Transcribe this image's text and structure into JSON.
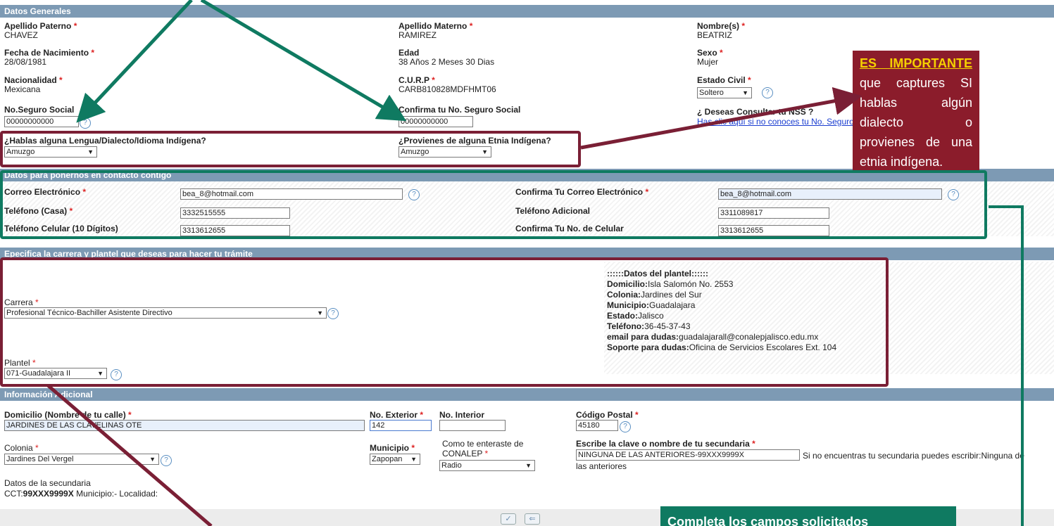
{
  "sections": {
    "general": "Datos Generales",
    "contact": "Datos para ponernos en contacto contigo",
    "career": "Epecifica la carrera y plantel que deseas para hacer tu trámite",
    "additional": "Información Adicional"
  },
  "general": {
    "apellido_paterno": {
      "label": "Apellido Paterno",
      "value": "CHAVEZ"
    },
    "apellido_materno": {
      "label": "Apellido Materno",
      "value": "RAMIREZ"
    },
    "nombre": {
      "label": "Nombre(s)",
      "value": "BEATRIZ"
    },
    "fecha_nacimiento": {
      "label": "Fecha de Nacimiento",
      "value": "28/08/1981"
    },
    "edad": {
      "label": "Edad",
      "value": "38 Años 2 Meses 30 Dias"
    },
    "sexo": {
      "label": "Sexo",
      "value": "Mujer"
    },
    "nacionalidad": {
      "label": "Nacionalidad",
      "value": "Mexicana"
    },
    "curp": {
      "label": "C.U.R.P",
      "value": "CARB810828MDFHMT06"
    },
    "estado_civil": {
      "label": "Estado Civil",
      "value": "Soltero"
    },
    "nss": {
      "label": "No.Seguro Social",
      "value": "00000000000"
    },
    "nss_confirm": {
      "label": "Confirma tu No. Seguro Social",
      "value": "00000000000"
    },
    "consultar_nss": {
      "label": "¿ Deseas Consultar tu NSS ?",
      "link": "Has clic aquí si no conoces tu No. Seguro Social"
    },
    "lengua": {
      "label": "¿Hablas alguna Lengua/Dialecto/Idioma Indígena?",
      "value": "Amuzgo"
    },
    "etnia": {
      "label": "¿Provienes de alguna Etnia Indígena?",
      "value": "Amuzgo"
    }
  },
  "contact": {
    "correo": {
      "label": "Correo Electrónico",
      "value": "bea_8@hotmail.com"
    },
    "correo_confirm": {
      "label": "Confirma Tu Correo Electrónico",
      "value": "bea_8@hotmail.com"
    },
    "tel_casa": {
      "label": "Teléfono (Casa)",
      "value": "3332515555"
    },
    "tel_adicional": {
      "label": "Teléfono Adicional",
      "value": "3311089817"
    },
    "tel_celular": {
      "label": "Teléfono Celular (10 Dígitos)",
      "value": "3313612655"
    },
    "celular_confirm": {
      "label": "Confirma Tu No. de Celular",
      "value": "3313612655"
    }
  },
  "career": {
    "carrera": {
      "label": "Carrera",
      "value": "Profesional Técnico-Bachiller Asistente Directivo"
    },
    "plantel": {
      "label": "Plantel",
      "value": "071-Guadalajara II"
    },
    "plantel_info": {
      "title": "::::::Datos del plantel::::::",
      "domicilio_label": "Domicilio:",
      "domicilio": "Isla Salomón No. 2553",
      "colonia_label": "Colonia:",
      "colonia": "Jardines del Sur",
      "municipio_label": "Municipio:",
      "municipio": "Guadalajara",
      "estado_label": "Estado:",
      "estado": "Jalisco",
      "telefono_label": "Teléfono:",
      "telefono": "36-45-37-43",
      "email_label": "email para dudas:",
      "email": "guadalajarall@conalepjalisco.edu.mx",
      "soporte_label": "Soporte para dudas:",
      "soporte": "Oficina de Servicios Escolares Ext. 104"
    }
  },
  "additional": {
    "domicilio": {
      "label": "Domicilio (Nombre de tu calle)",
      "value": "JARDINES DE LAS CLAVELINAS OTE"
    },
    "no_exterior": {
      "label": "No. Exterior",
      "value": "142"
    },
    "no_interior": {
      "label": "No. Interior",
      "value": ""
    },
    "codigo_postal": {
      "label": "Código Postal",
      "value": "45180"
    },
    "colonia": {
      "label": "Colonia",
      "value": "Jardines Del Vergel"
    },
    "municipio": {
      "label": "Municipio",
      "value": "Zapopan"
    },
    "enteraste": {
      "label_1": "Como te enteraste de",
      "label_2": "CONALEP",
      "value": "Radio"
    },
    "secundaria": {
      "label": "Escribe la clave o nombre de tu secundaria",
      "value": "NINGUNA DE LAS ANTERIORES-99XXX9999X",
      "hint_1": "Si no encuentras tu secundaria puedes escribir:Ninguna de",
      "hint_2": "las anteriores"
    },
    "datos_secundaria": {
      "label": "Datos de la secundaria",
      "cct_prefix": "CCT:",
      "cct": "99XXX9999X",
      "rest": " Municipio:- Localidad:"
    }
  },
  "buttons": {
    "accept": "✓",
    "back": "⇐"
  },
  "callouts": {
    "important_highlight": "ES IMPORTANTE",
    "important_rest": " que captures SI hablas algún dialecto o provienes de una etnia indígena.",
    "complete": "Completa los campos solicitados"
  },
  "colors": {
    "header": "#7d9ab4",
    "maroon": "#7a1f35",
    "green": "#0f7a61",
    "callout": "#8b1c2b",
    "highlight": "#f5d000"
  }
}
